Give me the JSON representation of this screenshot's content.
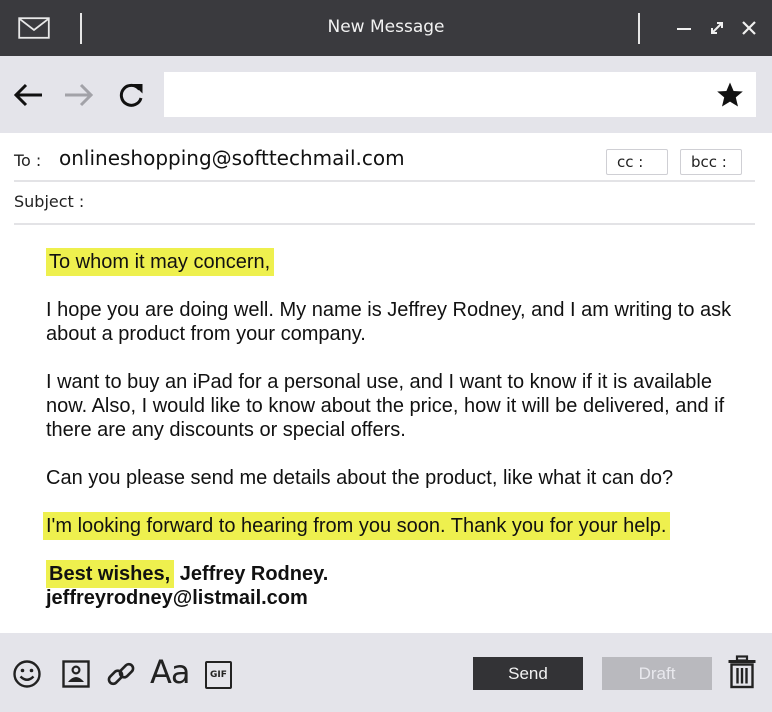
{
  "window": {
    "title": "New Message"
  },
  "browser": {
    "address_value": ""
  },
  "compose": {
    "to_label": "To :",
    "to_value": "onlineshopping@softtechmail.com",
    "cc_label": "cc :",
    "bcc_label": "bcc :",
    "subject_label": "Subject :",
    "subject_value": ""
  },
  "message": {
    "greeting": "To whom it may concern,",
    "paragraph_1": "I hope you are doing well. My name is Jeffrey Rodney, and I am writing to ask about a product from your company.",
    "paragraph_2": "I want to buy an iPad for a personal use, and I want to know if it is available now. Also, I would like to know about the price, how it will be delivered, and if there are any discounts or special offers.",
    "paragraph_3": "Can you please send me details about the product, like what it can do?",
    "closing_line": "I'm looking forward to hearing from you soon. Thank you for your help.",
    "sign_off": "Best wishes,",
    "signature_name": " Jeffrey Rodney.",
    "signature_email": "jeffreyrodney@listmail.com"
  },
  "toolbar": {
    "send_label": "Send",
    "draft_label": "Draft",
    "font_label": "Aa",
    "gif_label": "GIF"
  },
  "colors": {
    "titlebar": "#3a3a3e",
    "toolbar_bg": "#e4e4ea",
    "highlight": "#eef04e",
    "send_button": "#333336",
    "draft_button": "#b9b9be"
  },
  "icons": [
    "mail-icon",
    "minimize-icon",
    "maximize-icon",
    "close-icon",
    "back-arrow-icon",
    "forward-arrow-icon",
    "reload-icon",
    "star-icon",
    "emoji-icon",
    "image-icon",
    "link-icon",
    "font-icon",
    "gif-icon",
    "trash-icon"
  ]
}
